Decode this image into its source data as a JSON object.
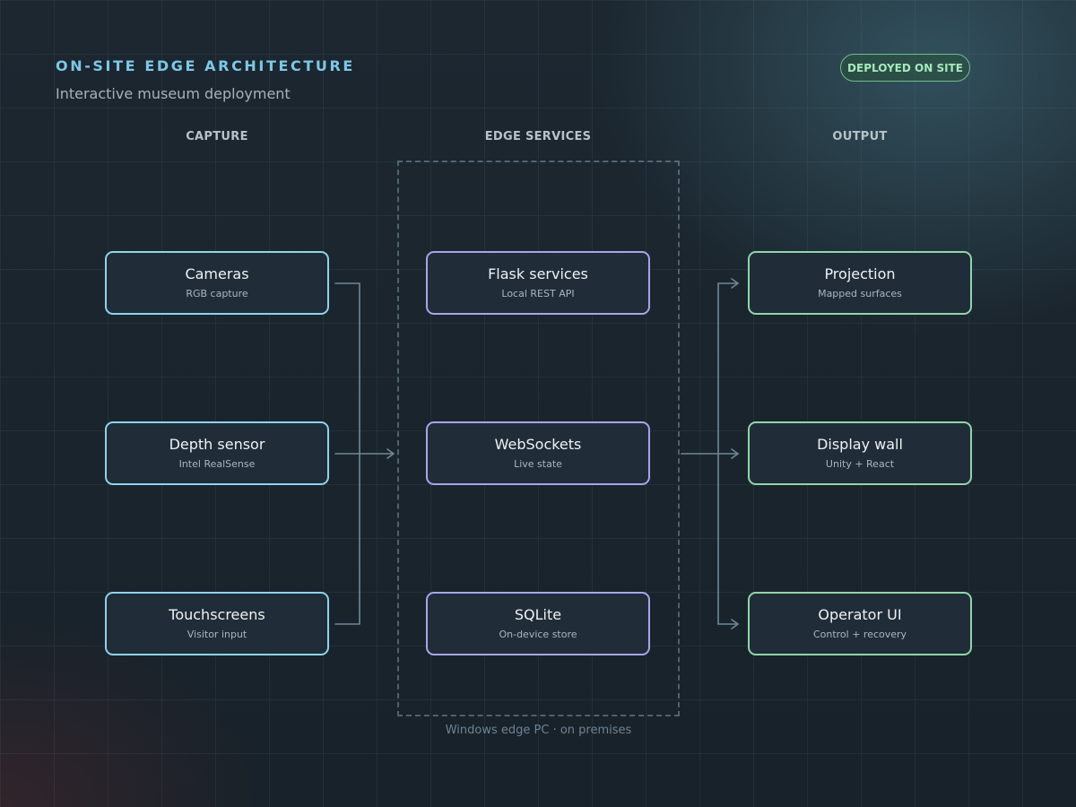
{
  "header": {
    "title": "ON-SITE EDGE ARCHITECTURE",
    "subtitle": "Interactive museum deployment",
    "badge": "DEPLOYED ON SITE"
  },
  "columns": {
    "capture": {
      "heading": "CAPTURE",
      "nodes": [
        {
          "title": "Cameras",
          "subtitle": "RGB capture"
        },
        {
          "title": "Depth sensor",
          "subtitle": "Intel RealSense"
        },
        {
          "title": "Touchscreens",
          "subtitle": "Visitor input"
        }
      ]
    },
    "edge": {
      "heading": "EDGE SERVICES",
      "nodes": [
        {
          "title": "Flask services",
          "subtitle": "Local REST API"
        },
        {
          "title": "WebSockets",
          "subtitle": "Live state"
        },
        {
          "title": "SQLite",
          "subtitle": "On-device store"
        }
      ],
      "frame_caption": "Windows edge PC · on premises"
    },
    "output": {
      "heading": "OUTPUT",
      "nodes": [
        {
          "title": "Projection",
          "subtitle": "Mapped surfaces"
        },
        {
          "title": "Display wall",
          "subtitle": "Unity + React"
        },
        {
          "title": "Operator UI",
          "subtitle": "Control + recovery"
        }
      ]
    }
  },
  "colors": {
    "capture_accent": "#8ed3ec",
    "edge_accent": "#a9a4ec",
    "output_accent": "#8fd6aa",
    "title_accent": "#7cc8e6",
    "badge_accent": "#6fbf8c",
    "connector": "#6f8896"
  }
}
